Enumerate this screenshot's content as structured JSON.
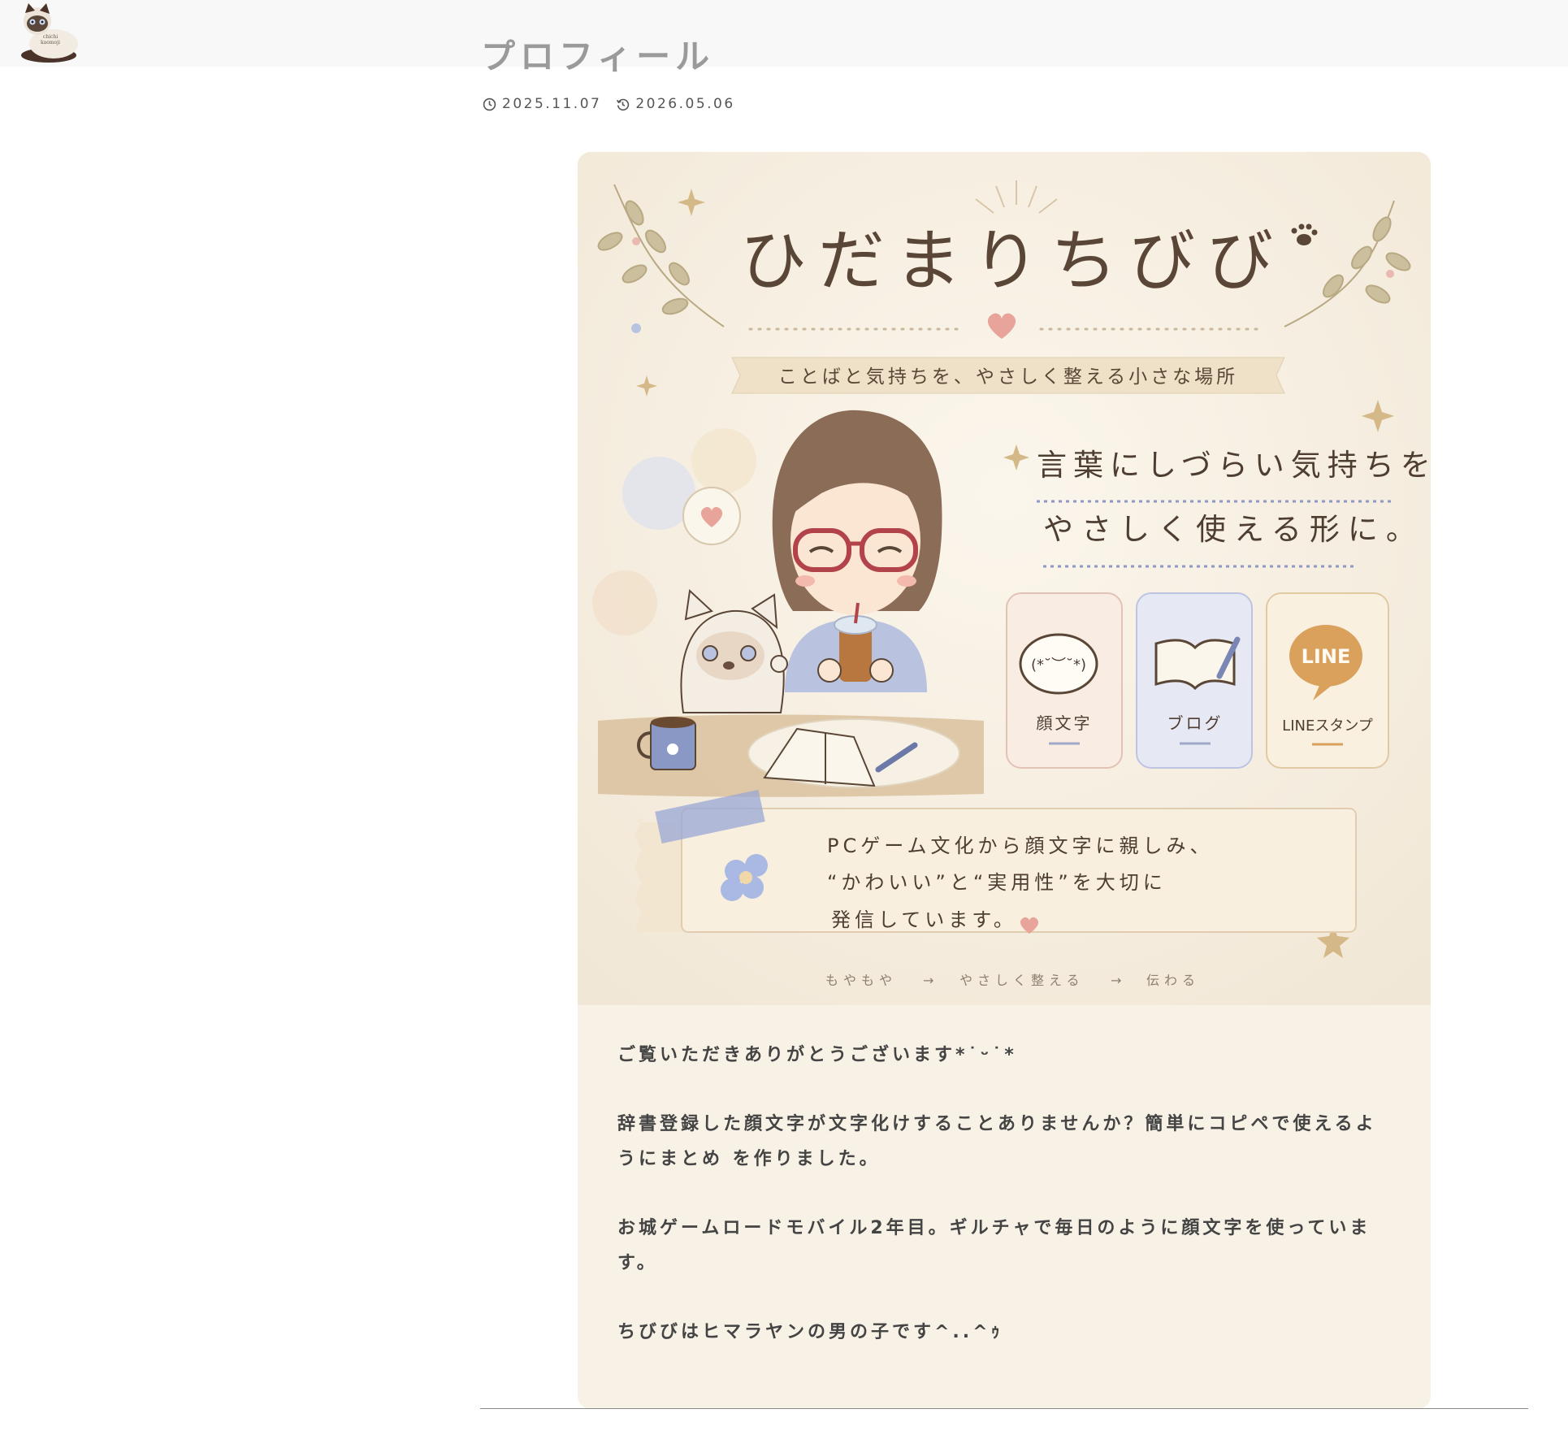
{
  "header": {
    "logo_text_top": "chichi",
    "logo_text_bottom": "kaomoji"
  },
  "page": {
    "title": "プロフィール",
    "published_date": "2025.11.07",
    "updated_date": "2026.05.06"
  },
  "banner": {
    "site_title": "ひだまりちびび",
    "tagline": "ことばと気持ちを、やさしく整える小さな場所",
    "headline_line1": "言葉にしづらい気持ちを、",
    "headline_line2": "やさしく使える形に。",
    "kaomoji_bubble": "(*˘︶˘*)",
    "line_logo": "LINE",
    "cards": [
      {
        "label": "顔文字"
      },
      {
        "label": "ブログ"
      },
      {
        "label": "LINEスタンプ"
      }
    ],
    "note_line1": "PCゲーム文化から顔文字に親しみ、",
    "note_line2": "“かわいい”と“実用性”を大切に",
    "note_line3": "発信しています。",
    "flow": [
      "もやもや",
      "やさしく整える",
      "伝わる"
    ],
    "arrow": "→"
  },
  "body": {
    "paragraphs": [
      "ご覧いただきありがとうございます*˙ᵕ˙*",
      "辞書登録した顔文字が文字化けすることありませんか？簡単にコピペで使えるようにまとめ を作りました。",
      "お城ゲームロードモバイル2年目。ギルチャで毎日のように顔文字を使っています。",
      "ちびびはヒマラヤンの男の子です^..^ｩ"
    ]
  },
  "colors": {
    "card_bg": "#f8f2e6",
    "accent_brown": "#5a4636",
    "heart_pink": "#e8a49a",
    "soft_blue": "#b9c3e0",
    "line_gold": "#d9a15c"
  }
}
